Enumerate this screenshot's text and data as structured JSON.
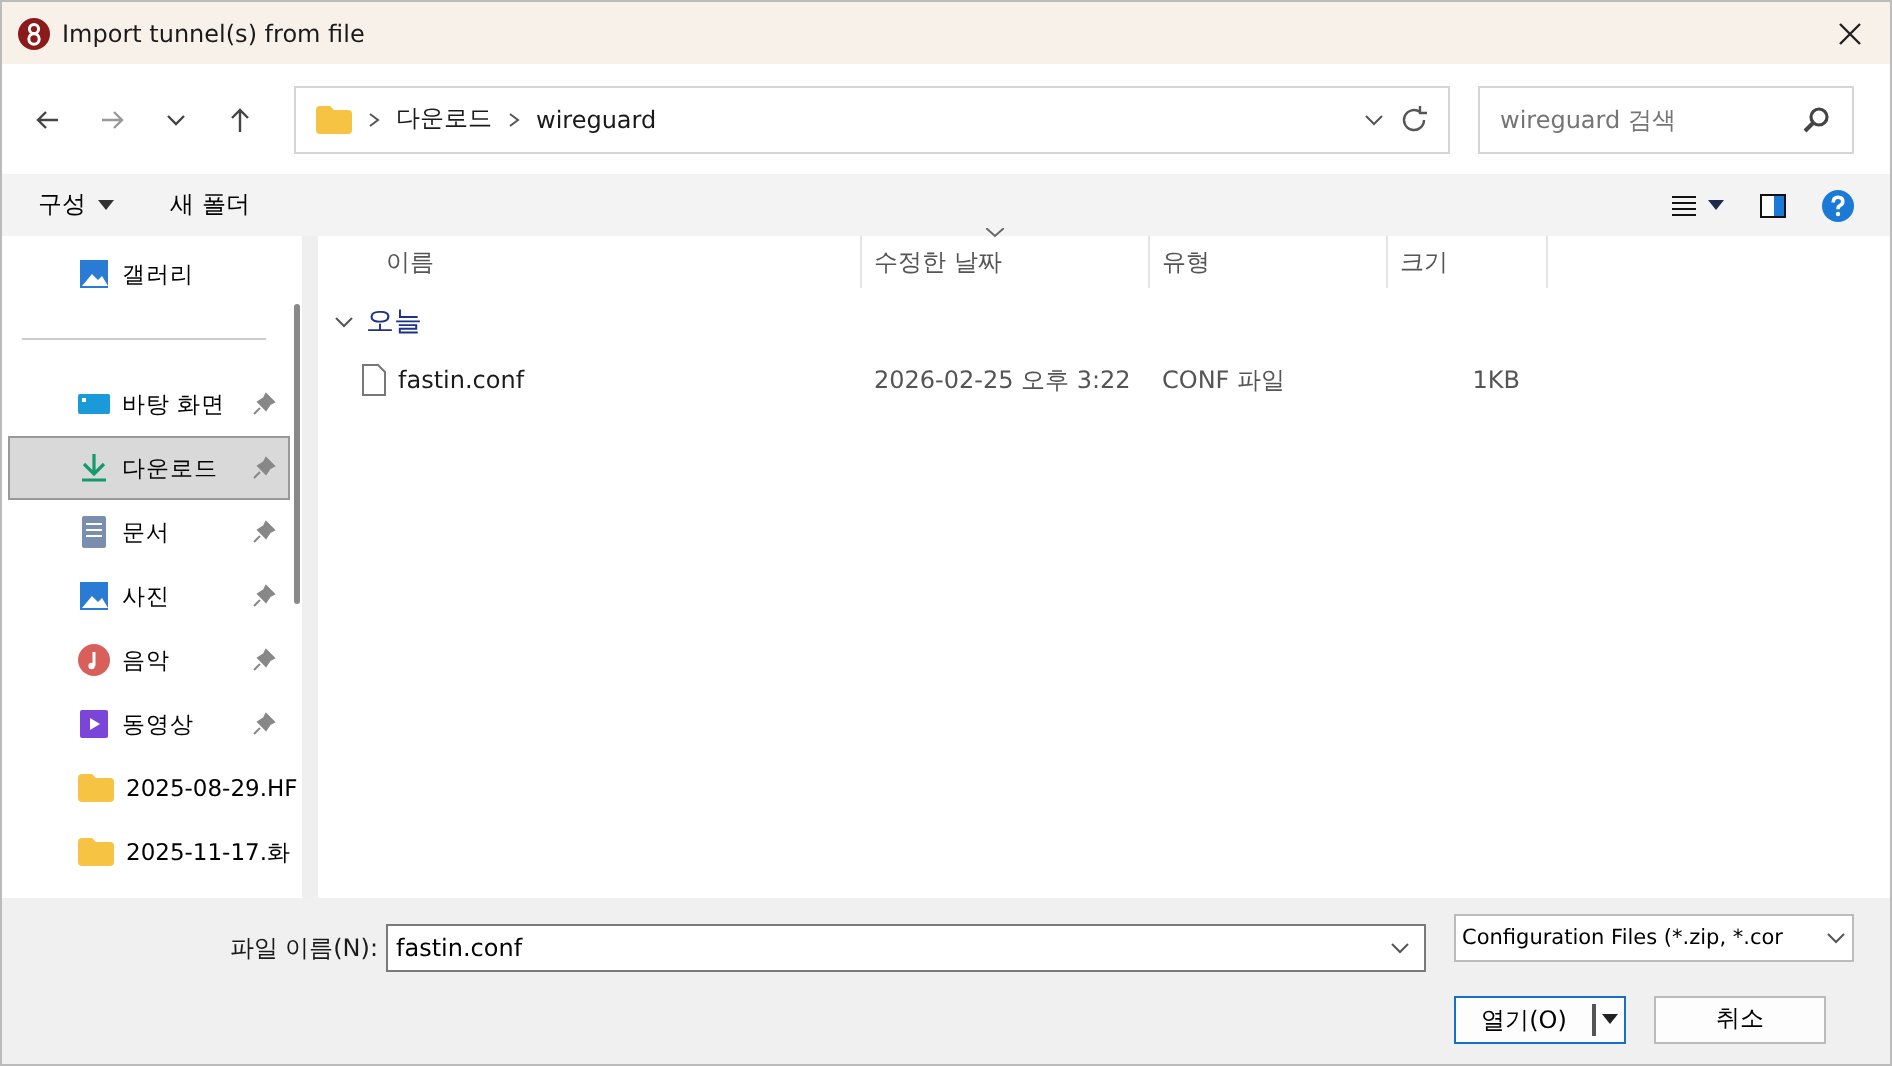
{
  "window": {
    "title": "Import tunnel(s) from file"
  },
  "address_bar": {
    "segments": [
      "다운로드",
      "wireguard"
    ]
  },
  "search": {
    "placeholder": "wireguard 검색"
  },
  "toolbar": {
    "organize": "구성",
    "new_folder": "새 폴더"
  },
  "sidebar": {
    "items": [
      {
        "label": "갤러리",
        "kind": "gallery",
        "pinned": false,
        "selected": false
      },
      {
        "kind": "separator"
      },
      {
        "label": "바탕 화면",
        "kind": "desktop",
        "pinned": true,
        "selected": false
      },
      {
        "label": "다운로드",
        "kind": "download",
        "pinned": true,
        "selected": true
      },
      {
        "label": "문서",
        "kind": "document",
        "pinned": true,
        "selected": false
      },
      {
        "label": "사진",
        "kind": "picture",
        "pinned": true,
        "selected": false
      },
      {
        "label": "음악",
        "kind": "music",
        "pinned": true,
        "selected": false
      },
      {
        "label": "동영상",
        "kind": "video",
        "pinned": true,
        "selected": false
      },
      {
        "label": "2025-08-29.HF",
        "kind": "folder",
        "pinned": false,
        "selected": false
      },
      {
        "label": "2025-11-17.화",
        "kind": "folder",
        "pinned": false,
        "selected": false
      }
    ]
  },
  "table": {
    "columns": [
      "이름",
      "수정한 날짜",
      "유형",
      "크기"
    ],
    "groups": [
      {
        "label": "오늘",
        "expanded": true,
        "rows": [
          {
            "cells": [
              "fastin.conf",
              "2026-02-25 오후 3:22",
              "CONF 파일",
              "1KB"
            ]
          }
        ]
      }
    ]
  },
  "footer": {
    "filename_label": "파일 이름(N):",
    "filename": "fastin.conf",
    "filter": "Configuration Files (*.zip, *.cor",
    "open": "열기(O)",
    "cancel": "취소"
  }
}
